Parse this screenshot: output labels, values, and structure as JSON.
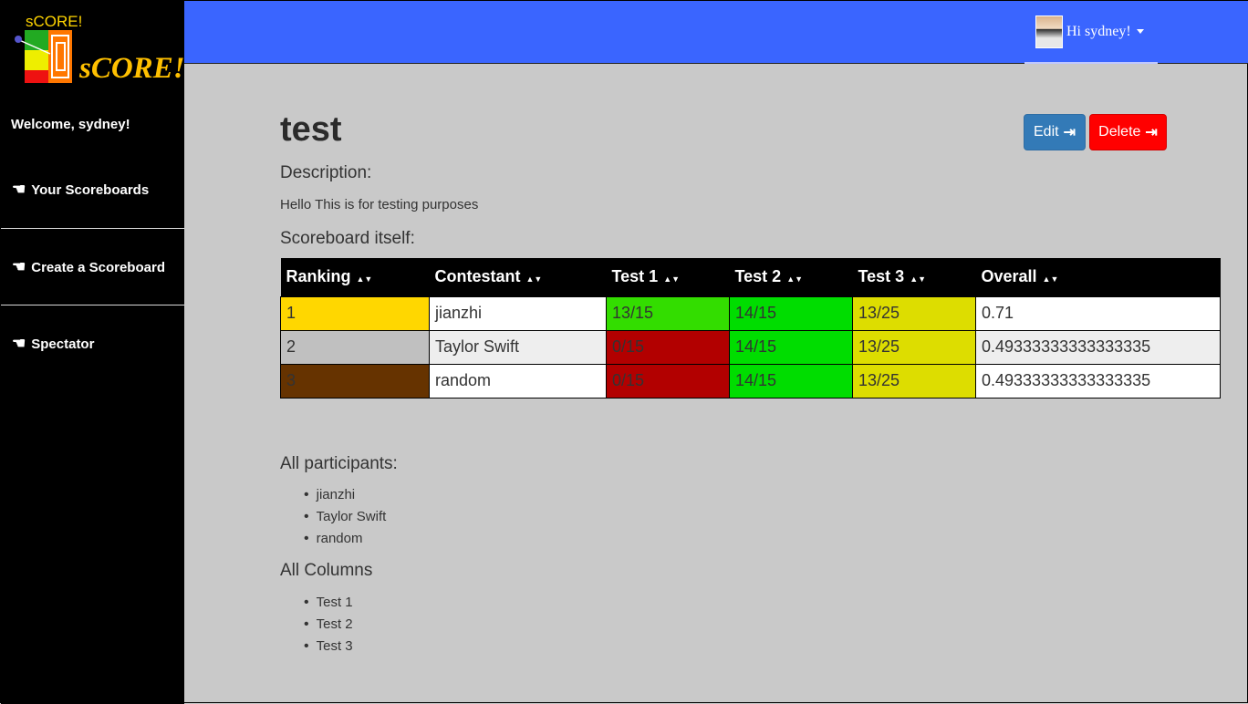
{
  "app": {
    "logo_small": "sCORE!",
    "logo_big": "sCORE!",
    "welcome": "Welcome, sydney!"
  },
  "sidebar": {
    "items": [
      {
        "label": "Your Scoreboards",
        "icon": "pointing-hand-icon"
      },
      {
        "label": "Create a Scoreboard",
        "icon": "pointing-hand-icon"
      },
      {
        "label": "Spectator",
        "icon": "pointing-hand-icon"
      }
    ]
  },
  "topbar": {
    "greeting": "Hi sydney!",
    "accent": "#3a65ff"
  },
  "page": {
    "title": "test",
    "edit_label": "Edit",
    "delete_label": "Delete",
    "description_heading": "Description:",
    "description_text": "Hello This is for testing purposes",
    "scoreboard_heading": "Scoreboard itself:",
    "participants_heading": "All participants:",
    "columns_heading": "All Columns"
  },
  "table": {
    "headers": [
      "Ranking",
      "Contestant",
      "Test 1",
      "Test 2",
      "Test 3",
      "Overall"
    ],
    "rows": [
      {
        "cells": [
          "1",
          "jianzhi",
          "13/15",
          "14/15",
          "13/25",
          "0.71"
        ],
        "colors": [
          "#ffd700",
          "#ffffff",
          "#33dd00",
          "#00dd00",
          "#dddd00",
          "#ffffff"
        ]
      },
      {
        "cells": [
          "2",
          "Taylor Swift",
          "0/15",
          "14/15",
          "13/25",
          "0.49333333333333335"
        ],
        "colors": [
          "#c0c0c0",
          "#eeeeee",
          "#b20000",
          "#00dd00",
          "#dddd00",
          "#eeeeee"
        ]
      },
      {
        "cells": [
          "3",
          "random",
          "0/15",
          "14/15",
          "13/25",
          "0.49333333333333335"
        ],
        "colors": [
          "#663300",
          "#ffffff",
          "#b20000",
          "#00dd00",
          "#dddd00",
          "#ffffff"
        ]
      }
    ]
  },
  "participants": [
    "jianzhi",
    "Taylor Swift",
    "random"
  ],
  "columns": [
    "Test 1",
    "Test 2",
    "Test 3"
  ]
}
